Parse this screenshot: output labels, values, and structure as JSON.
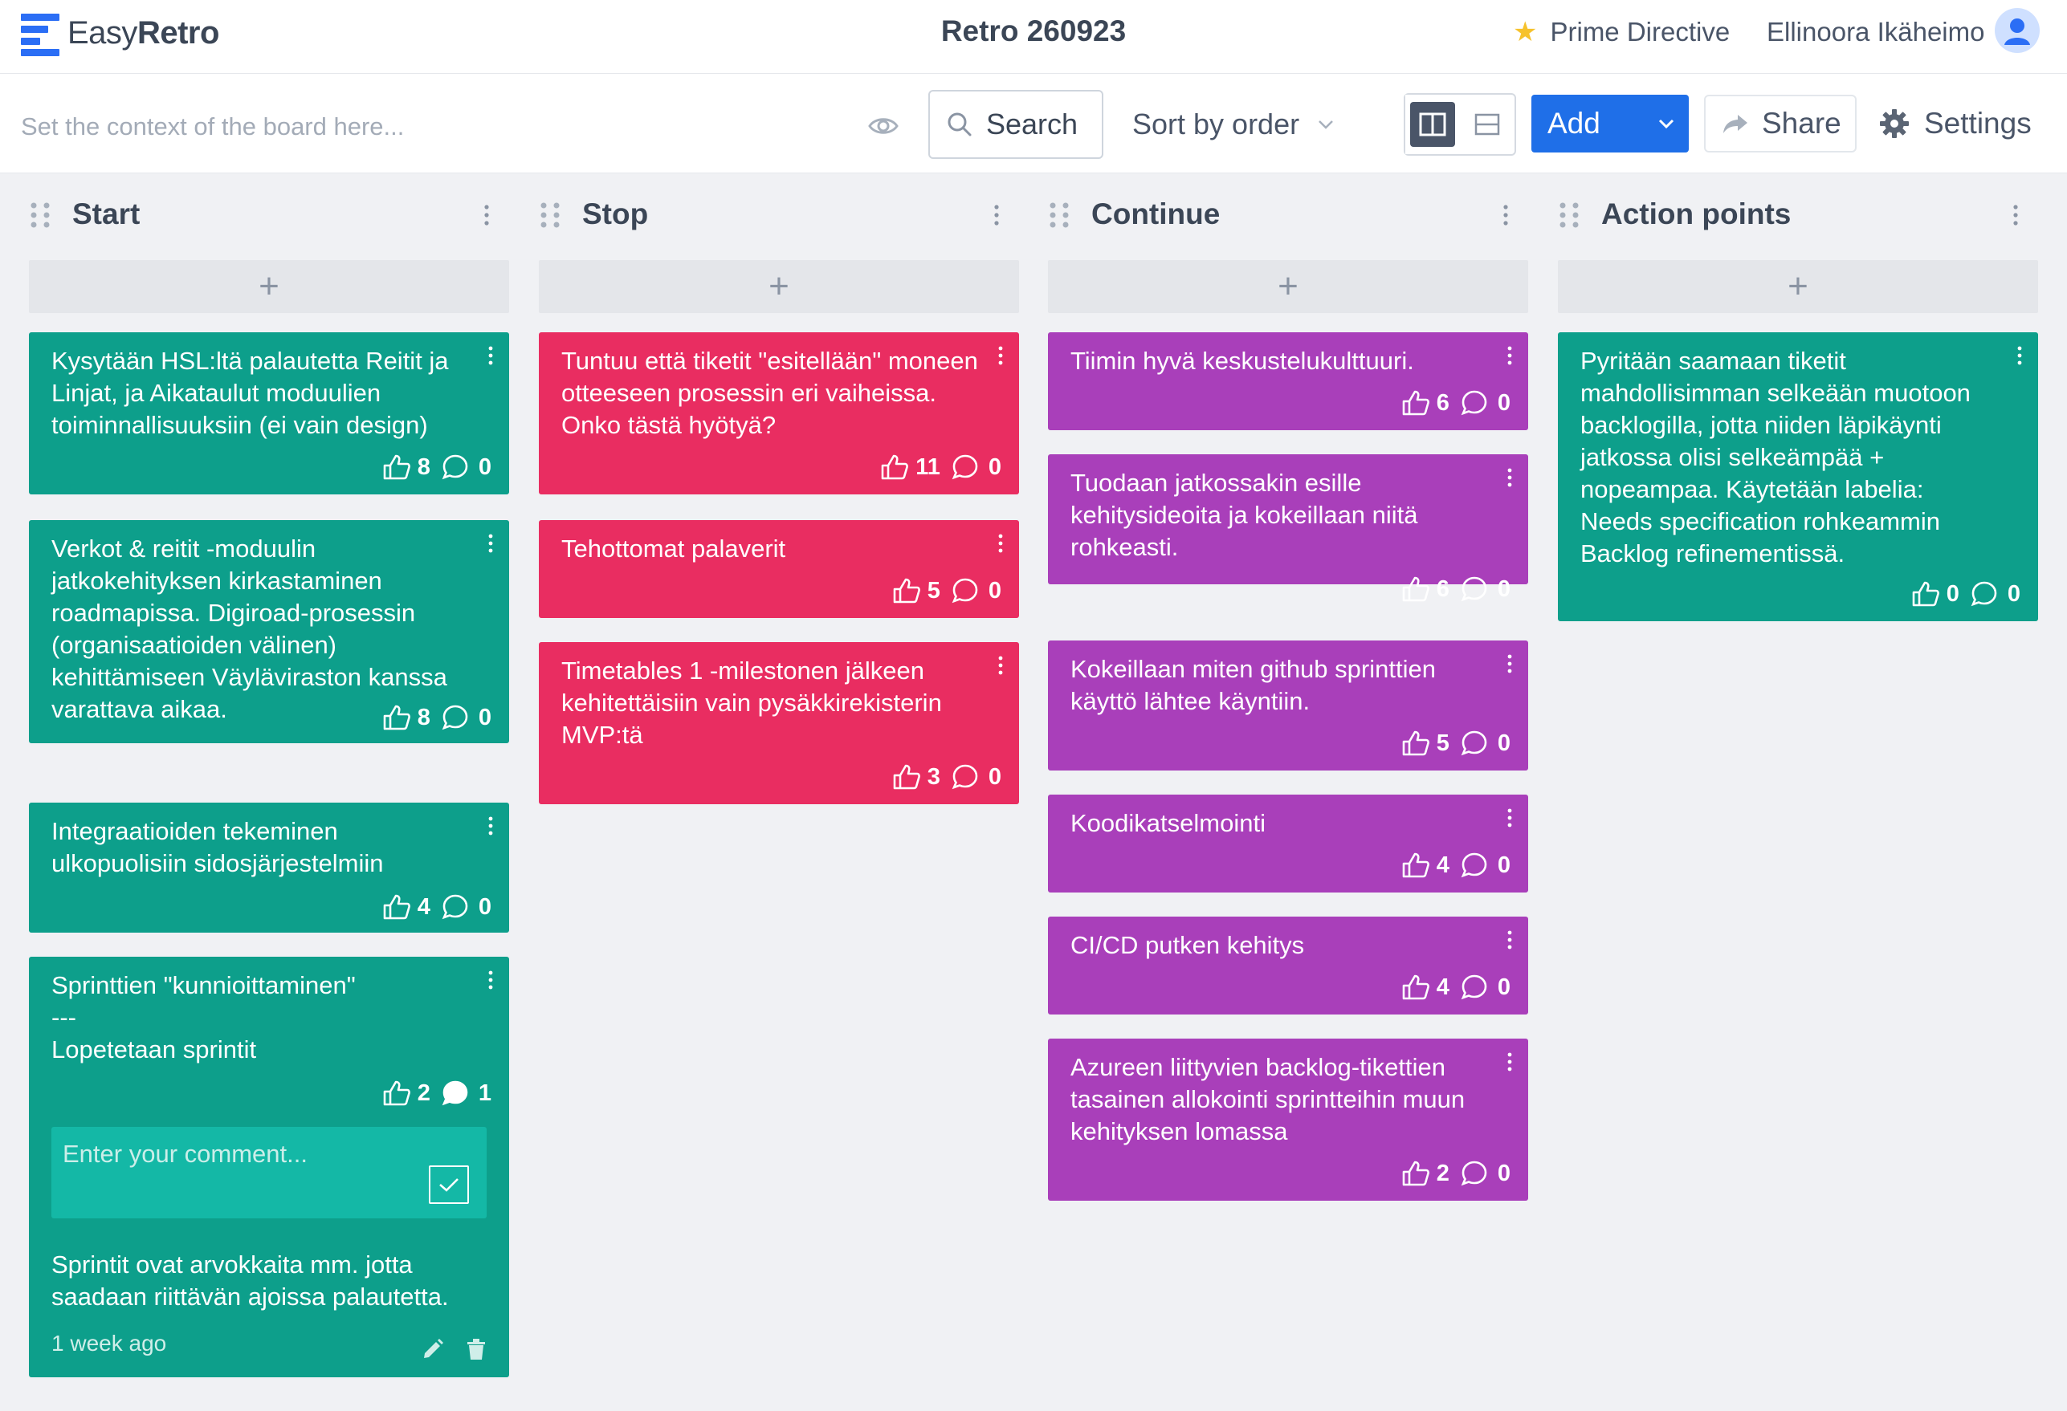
{
  "app": {
    "logo_light": "Easy",
    "logo_bold": "Retro",
    "board_title": "Retro 260923"
  },
  "header": {
    "prime_directive": "Prime Directive",
    "user_name": "Ellinoora Ikäheimo"
  },
  "toolbar": {
    "context_placeholder": "Set the context of the board here...",
    "search_label": "Search",
    "sort_label": "Sort by order",
    "add_label": "Add",
    "share_label": "Share",
    "settings_label": "Settings"
  },
  "colors": {
    "green": "#0d9f8b",
    "red": "#e92d61",
    "purple": "#a93fba",
    "accent": "#1f6fe8"
  },
  "columns": [
    {
      "title": "Start",
      "cards": [
        {
          "text": "Kysytään HSL:ltä palautetta Reitit ja Linjat, ja Aikataulut moduulien toiminnallisuuksiin (ei vain design)",
          "likes": "8",
          "comments": "0"
        },
        {
          "text": "Verkot & reitit -moduulin jatkokehityksen kirkastaminen roadmapissa. Digiroad-prosessin (organisaatioiden välinen) kehittämiseen Väyläviraston kanssa varattava aikaa.",
          "likes": "8",
          "comments": "0"
        },
        {
          "text": "Integraatioiden tekeminen ulkopuolisiin sidosjärjestelmiin",
          "likes": "4",
          "comments": "0"
        },
        {
          "text": "Sprinttien \"kunnioittaminen\"\n---\nLopetetaan sprintit",
          "likes": "2",
          "comments": "1",
          "comment_placeholder": "Enter your comment...",
          "comment_text": "Sprintit ovat arvokkaita mm. jotta saadaan riittävän ajoissa palautetta.",
          "comment_time": "1 week ago"
        }
      ]
    },
    {
      "title": "Stop",
      "cards": [
        {
          "text": "Tuntuu että tiketit \"esitellään\" moneen otteeseen prosessin eri vaiheissa. Onko tästä hyötyä?",
          "likes": "11",
          "comments": "0"
        },
        {
          "text": "Tehottomat palaverit",
          "likes": "5",
          "comments": "0"
        },
        {
          "text": "Timetables 1 -milestonen jälkeen kehitettäisiin vain pysäkkirekisterin MVP:tä",
          "likes": "3",
          "comments": "0"
        }
      ]
    },
    {
      "title": "Continue",
      "cards": [
        {
          "text": "Tiimin hyvä keskustelukulttuuri.",
          "likes": "6",
          "comments": "0"
        },
        {
          "text": "Tuodaan jatkossakin esille kehitysideoita ja kokeillaan niitä rohkeasti.",
          "likes": "6",
          "comments": "0"
        },
        {
          "text": "Kokeillaan miten github sprinttien käyttö lähtee käyntiin.",
          "likes": "5",
          "comments": "0"
        },
        {
          "text": "Koodikatselmointi",
          "likes": "4",
          "comments": "0"
        },
        {
          "text": "CI/CD putken kehitys",
          "likes": "4",
          "comments": "0"
        },
        {
          "text": "Azureen liittyvien backlog-tikettien tasainen allokointi sprintteihin muun kehityksen lomassa",
          "likes": "2",
          "comments": "0"
        }
      ]
    },
    {
      "title": "Action points",
      "cards": [
        {
          "text": "Pyritään saamaan tiketit mahdollisimman selkeään muotoon backlogilla, jotta niiden läpikäynti jatkossa olisi selkeämpää + nopeampaa. Käytetään labelia: Needs specification rohkeammin Backlog refinementissä.",
          "likes": "0",
          "comments": "0"
        }
      ]
    }
  ]
}
